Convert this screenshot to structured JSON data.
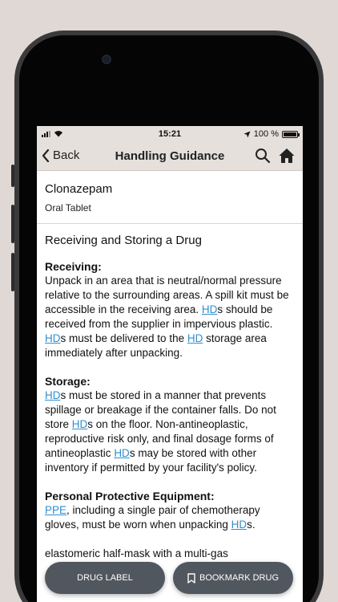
{
  "status_bar": {
    "time": "15:21",
    "battery": "100 %"
  },
  "nav": {
    "back_label": "Back",
    "title": "Handling Guidance"
  },
  "drug": {
    "name": "Clonazepam",
    "form": "Oral Tablet"
  },
  "section_title": "Receiving and Storing a Drug",
  "receiving": {
    "heading": "Receiving:",
    "t1": "Unpack in an area that is neutral/normal pressure relative to the surrounding areas. A spill kit must be accessible in the receiving area. ",
    "link1": "HD",
    "t2": "s should be received from the supplier in impervious plastic. ",
    "link2": "HD",
    "t3": "s must be delivered to the ",
    "link3": "HD",
    "t4": " storage area immediately after unpacking."
  },
  "storage": {
    "heading": "Storage:",
    "link1": "HD",
    "t1": "s must be stored in a manner that prevents spillage or breakage if the container falls. Do not store ",
    "link2": "HD",
    "t2": "s on the floor. Non-antineoplastic, reproductive risk only, and final dosage forms of antineoplastic ",
    "link3": "HD",
    "t3": "s may be stored with other inventory if permitted by your facility's policy."
  },
  "ppe": {
    "heading": "Personal Protective Equipment:",
    "link1": "PPE",
    "t1": ", including a single pair of chemotherapy gloves, must be worn when unpacking ",
    "link2": "HD",
    "t2": "s.",
    "t3": "elastomeric half-mask with a multi-gas"
  },
  "buttons": {
    "drug_label": "DRUG LABEL",
    "bookmark_drug": "BOOKMARK DRUG"
  }
}
